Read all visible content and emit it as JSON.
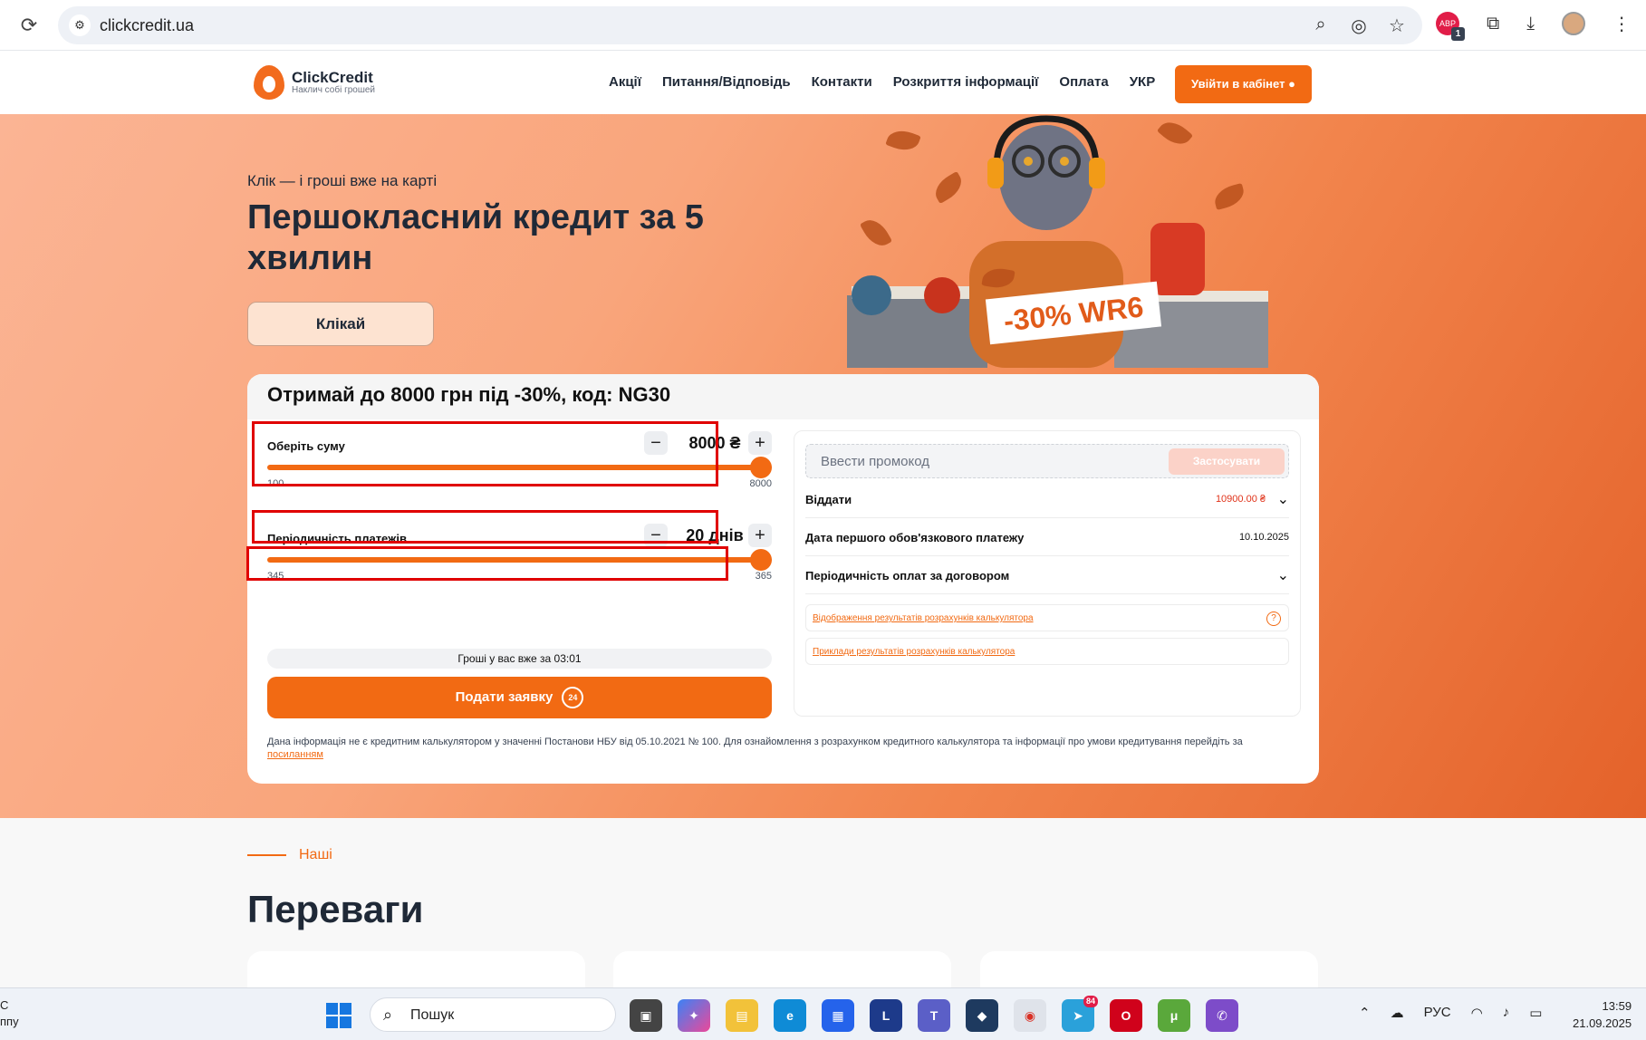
{
  "browser": {
    "url": "clickcredit.ua",
    "omnibox_icons": [
      "search-icon",
      "eye-off-icon",
      "star-icon"
    ],
    "extension_badge": "1"
  },
  "header": {
    "logo_name": "ClickCredit",
    "logo_tagline": "Наклич собі грошей",
    "nav": [
      "Акції",
      "Питання/Відповідь",
      "Контакти",
      "Розкриття інформації",
      "Оплата",
      "УКР"
    ],
    "login_label": "Увійти в кабінет"
  },
  "hero": {
    "subtitle": "Клік — і гроші вже на карті",
    "title": "Першокласний кредит за 5 хвилин",
    "cta_label": "Клікай",
    "promo_art_text": "-30% WR6"
  },
  "calculator": {
    "heading": "Отримай до 8000 грн під -30%, код: NG30",
    "amount": {
      "label": "Оберіть суму",
      "value": "8000 ₴",
      "min": "100",
      "max": "8000",
      "fill": 1.0
    },
    "period": {
      "label": "Періодичність платежів",
      "value": "20 днів",
      "min": "345",
      "max": "365",
      "fill": 1.0
    },
    "timer_text": "Гроші у вас вже за 03:01",
    "submit_label": "Подати заявку",
    "submit_badge": "24",
    "disclaimer": "Дана інформація не є кредитним калькулятором у значенні Постанови НБУ від 05.10.2021 № 100. Для ознайомлення з розрахунком кредитного калькулятора та інформації про умови кредитування перейдіть за",
    "disclaimer_link": "посиланням",
    "promo_placeholder": "Ввести промокод",
    "promo_apply": "Застосувати",
    "rows": [
      {
        "label": "Віддати",
        "value": "10900.00 ₴"
      },
      {
        "label": "Дата першого обов'язкового платежу",
        "value": "10.10.2025"
      },
      {
        "label": "Періодичність оплат за договором",
        "value": ""
      }
    ],
    "links": [
      "Відображення результатів розрахунків калькулятора",
      "Приклади результатів розрахунків калькулятора"
    ]
  },
  "advantages": {
    "kicker": "Наші",
    "title": "Переваги"
  },
  "taskbar": {
    "weather_top": "С",
    "weather_bottom": "ппу",
    "search_placeholder": "Пошук",
    "telegram_badge": "84",
    "language": "РУС",
    "time": "13:59",
    "date": "21.09.2025"
  },
  "colors": {
    "accent": "#f26a13",
    "highlight_box": "#e00000"
  }
}
